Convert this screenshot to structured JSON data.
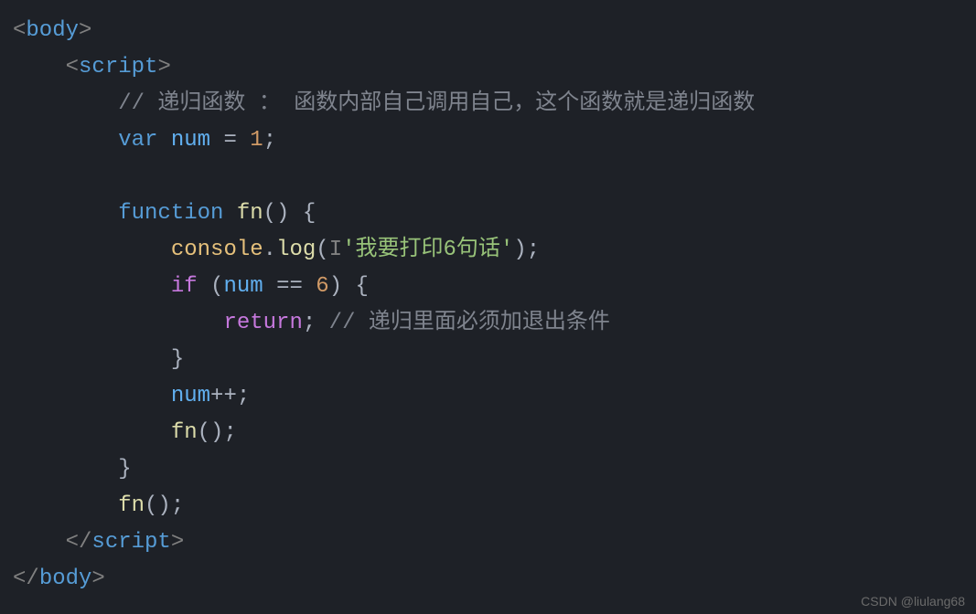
{
  "code": {
    "lines": [
      {
        "indent": "",
        "tokens": [
          {
            "cls": "tag",
            "t": "<"
          },
          {
            "cls": "tag-name",
            "t": "body"
          },
          {
            "cls": "tag",
            "t": ">"
          }
        ]
      },
      {
        "indent": "    ",
        "tokens": [
          {
            "cls": "tag",
            "t": "<"
          },
          {
            "cls": "tag-name",
            "t": "script"
          },
          {
            "cls": "tag",
            "t": ">"
          }
        ]
      },
      {
        "indent": "        ",
        "tokens": [
          {
            "cls": "comment",
            "t": "// 递归函数 ： 函数内部自己调用自己，这个函数就是递归函数"
          }
        ]
      },
      {
        "indent": "        ",
        "tokens": [
          {
            "cls": "keyword-blue",
            "t": "var"
          },
          {
            "cls": "white",
            "t": " "
          },
          {
            "cls": "variable",
            "t": "num"
          },
          {
            "cls": "white",
            "t": " "
          },
          {
            "cls": "operator",
            "t": "="
          },
          {
            "cls": "white",
            "t": " "
          },
          {
            "cls": "number",
            "t": "1"
          },
          {
            "cls": "semicolon",
            "t": ";"
          }
        ]
      },
      {
        "indent": "",
        "tokens": []
      },
      {
        "indent": "        ",
        "tokens": [
          {
            "cls": "keyword-blue",
            "t": "function"
          },
          {
            "cls": "white",
            "t": " "
          },
          {
            "cls": "function-name",
            "t": "fn"
          },
          {
            "cls": "paren",
            "t": "()"
          },
          {
            "cls": "white",
            "t": " "
          },
          {
            "cls": "brace",
            "t": "{"
          }
        ]
      },
      {
        "indent": "            ",
        "tokens": [
          {
            "cls": "object",
            "t": "console"
          },
          {
            "cls": "white",
            "t": "."
          },
          {
            "cls": "function-name",
            "t": "log"
          },
          {
            "cls": "paren",
            "t": "("
          },
          {
            "cls": "cursor-mark",
            "t": "I"
          },
          {
            "cls": "string",
            "t": "'我要打印6句话'"
          },
          {
            "cls": "paren",
            "t": ")"
          },
          {
            "cls": "semicolon",
            "t": ";"
          }
        ]
      },
      {
        "indent": "            ",
        "tokens": [
          {
            "cls": "keyword-purple",
            "t": "if"
          },
          {
            "cls": "white",
            "t": " "
          },
          {
            "cls": "paren",
            "t": "("
          },
          {
            "cls": "variable",
            "t": "num"
          },
          {
            "cls": "white",
            "t": " "
          },
          {
            "cls": "operator",
            "t": "=="
          },
          {
            "cls": "white",
            "t": " "
          },
          {
            "cls": "number",
            "t": "6"
          },
          {
            "cls": "paren",
            "t": ")"
          },
          {
            "cls": "white",
            "t": " "
          },
          {
            "cls": "brace",
            "t": "{"
          }
        ]
      },
      {
        "indent": "                ",
        "tokens": [
          {
            "cls": "keyword-purple",
            "t": "return"
          },
          {
            "cls": "semicolon",
            "t": ";"
          },
          {
            "cls": "white",
            "t": " "
          },
          {
            "cls": "comment",
            "t": "// 递归里面必须加退出条件"
          }
        ]
      },
      {
        "indent": "            ",
        "tokens": [
          {
            "cls": "brace",
            "t": "}"
          }
        ]
      },
      {
        "indent": "            ",
        "tokens": [
          {
            "cls": "variable",
            "t": "num"
          },
          {
            "cls": "operator",
            "t": "++"
          },
          {
            "cls": "semicolon",
            "t": ";"
          }
        ]
      },
      {
        "indent": "            ",
        "tokens": [
          {
            "cls": "function-name",
            "t": "fn"
          },
          {
            "cls": "paren",
            "t": "()"
          },
          {
            "cls": "semicolon",
            "t": ";"
          }
        ]
      },
      {
        "indent": "        ",
        "tokens": [
          {
            "cls": "brace",
            "t": "}"
          }
        ]
      },
      {
        "indent": "        ",
        "tokens": [
          {
            "cls": "function-name",
            "t": "fn"
          },
          {
            "cls": "paren",
            "t": "()"
          },
          {
            "cls": "semicolon",
            "t": ";"
          }
        ]
      },
      {
        "indent": "    ",
        "tokens": [
          {
            "cls": "tag",
            "t": "</"
          },
          {
            "cls": "tag-name",
            "t": "script"
          },
          {
            "cls": "tag",
            "t": ">"
          }
        ]
      },
      {
        "indent": "",
        "tokens": [
          {
            "cls": "tag",
            "t": "</"
          },
          {
            "cls": "tag-name",
            "t": "body"
          },
          {
            "cls": "tag",
            "t": ">"
          }
        ]
      }
    ]
  },
  "watermark": "CSDN @liulang68"
}
